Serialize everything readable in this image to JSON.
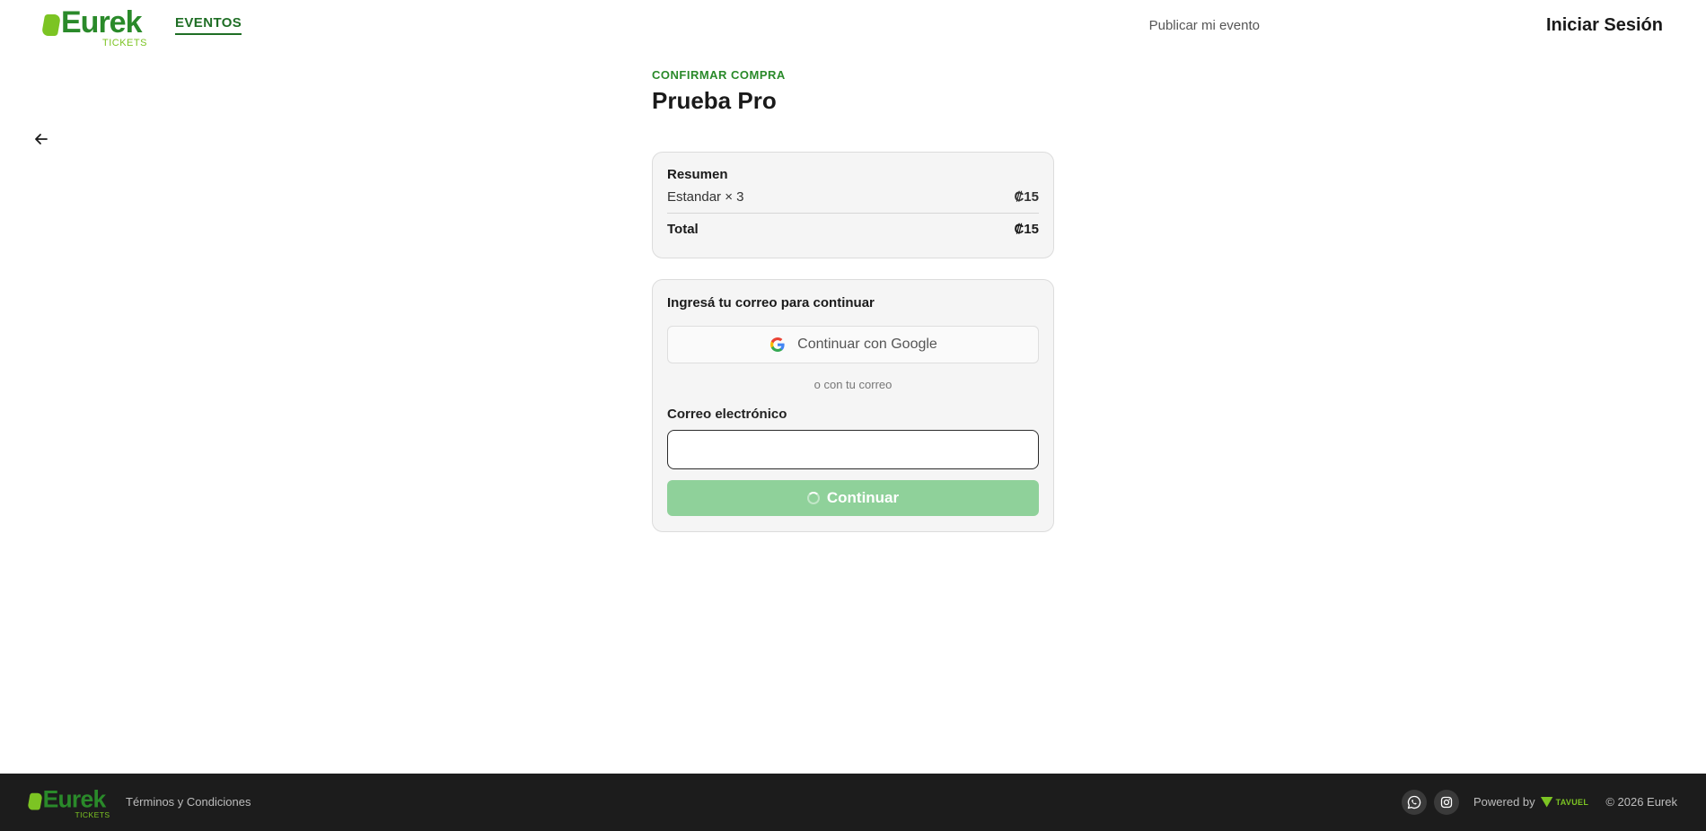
{
  "header": {
    "logo_word": "Eurek",
    "logo_sub": "TICKETS",
    "nav_events": "EVENTOS",
    "nav_publish": "Publicar mi evento",
    "nav_login": "Iniciar Sesión"
  },
  "page": {
    "eyebrow": "CONFIRMAR COMPRA",
    "title": "Prueba Pro"
  },
  "summary": {
    "heading": "Resumen",
    "line_item_label": "Estandar × 3",
    "line_item_amount": "₡15",
    "total_label": "Total",
    "total_amount": "₡15"
  },
  "login": {
    "heading": "Ingresá tu correo para continuar",
    "google_label": "Continuar con Google",
    "divider": "o con tu correo",
    "email_label": "Correo electrónico",
    "email_value": "",
    "continue_label": "Continuar"
  },
  "footer": {
    "logo_word": "Eurek",
    "logo_sub": "TICKETS",
    "terms": "Términos y Condiciones",
    "powered_by": "Powered by",
    "partner_name": "TAVUEL",
    "copyright": "© 2026 Eurek"
  },
  "colors": {
    "brand_green": "#2a8a2a",
    "leaf_green": "#7cc423",
    "button_disabled": "#8fd19a",
    "footer_bg": "#1c1c1c"
  },
  "icons": {
    "back": "arrow-left-icon",
    "google": "google-icon",
    "spinner": "spinner-icon",
    "whatsapp": "whatsapp-icon",
    "instagram": "instagram-icon"
  }
}
